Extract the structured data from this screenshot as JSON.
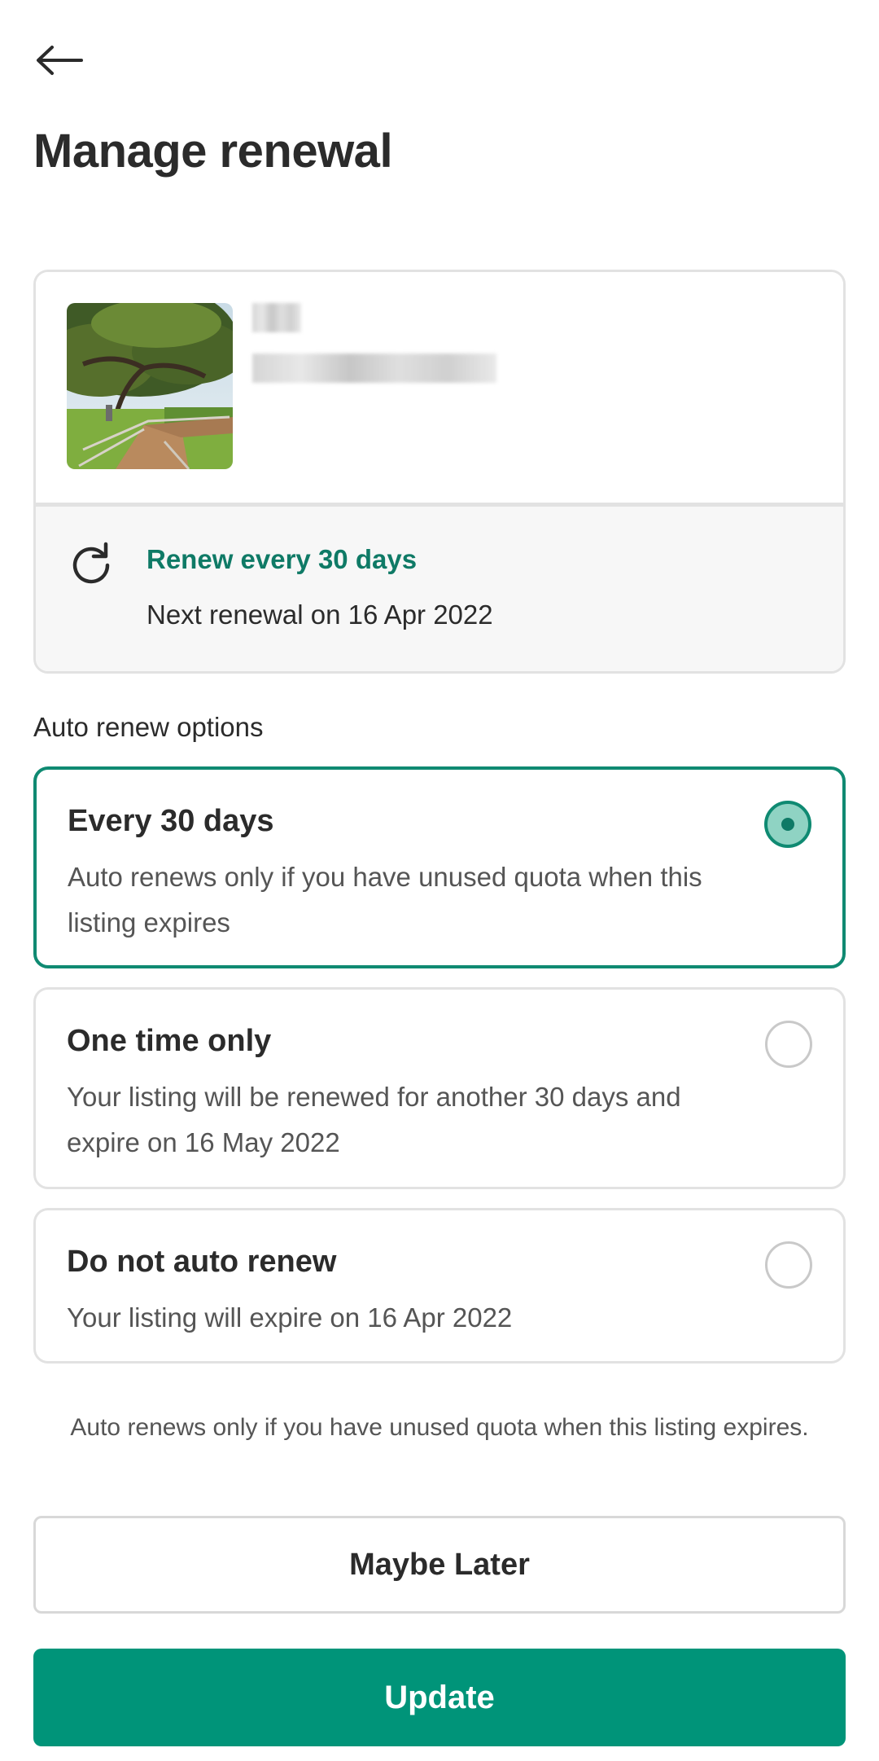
{
  "header": {
    "back_icon": "arrow-left-icon",
    "title": "Manage renewal"
  },
  "listing": {
    "thumbnail": "park-path-with-trees",
    "renew_icon": "refresh-icon",
    "renew_title": "Renew every 30 days",
    "next_renewal": "Next renewal on 16 Apr 2022"
  },
  "options_section": {
    "label": "Auto renew options",
    "options": [
      {
        "title": "Every 30 days",
        "description": "Auto renews only if you have unused quota when this listing expires",
        "selected": true
      },
      {
        "title": "One time only",
        "description": "Your listing will be renewed for another 30 days and expire on 16 May 2022",
        "selected": false
      },
      {
        "title": "Do not auto renew",
        "description": "Your listing will expire on 16 Apr 2022",
        "selected": false
      }
    ]
  },
  "footnote": "Auto renews only if you have unused quota when this listing expires.",
  "actions": {
    "later_label": "Maybe Later",
    "update_label": "Update"
  },
  "colors": {
    "accent": "#009479",
    "accent_text": "#0f7a66",
    "radio_fill": "#8fd3c3"
  }
}
